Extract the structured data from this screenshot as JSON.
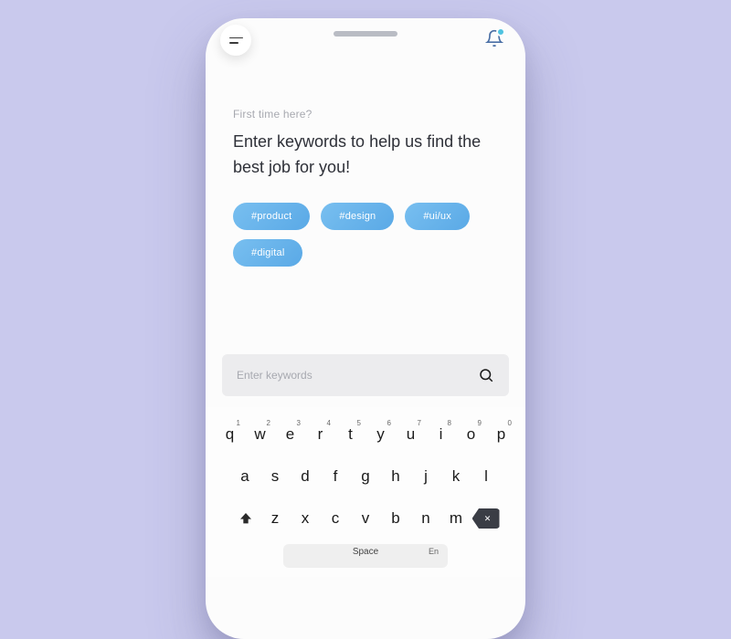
{
  "header": {
    "subtitle": "First time here?",
    "title": "Enter keywords to help us find the best job for you!"
  },
  "tags": [
    "#product",
    "#design",
    "#ui/ux",
    "#digital"
  ],
  "search": {
    "placeholder": "Enter keywords"
  },
  "keyboard": {
    "row1": [
      {
        "ch": "q",
        "num": "1"
      },
      {
        "ch": "w",
        "num": "2"
      },
      {
        "ch": "e",
        "num": "3"
      },
      {
        "ch": "r",
        "num": "4"
      },
      {
        "ch": "t",
        "num": "5"
      },
      {
        "ch": "y",
        "num": "6"
      },
      {
        "ch": "u",
        "num": "7"
      },
      {
        "ch": "i",
        "num": "8"
      },
      {
        "ch": "o",
        "num": "9"
      },
      {
        "ch": "p",
        "num": "0"
      }
    ],
    "row2": [
      "a",
      "s",
      "d",
      "f",
      "g",
      "h",
      "j",
      "k",
      "l"
    ],
    "row3": [
      "z",
      "x",
      "c",
      "v",
      "b",
      "n",
      "m"
    ],
    "space_label": "Space",
    "lang_label": "En"
  }
}
